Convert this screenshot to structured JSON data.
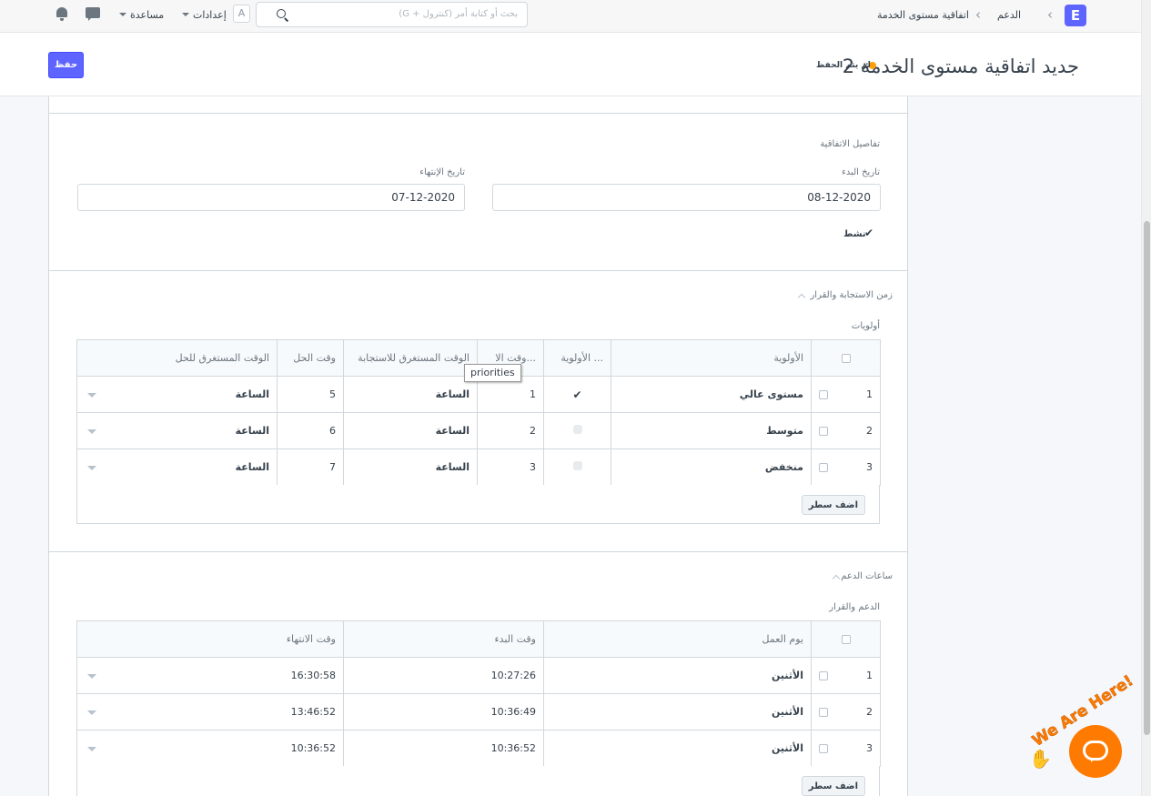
{
  "navbar": {
    "logo": "E",
    "breadcrumbs": [
      "الدعم",
      "اتفاقية مستوى الخدمة"
    ],
    "search_placeholder": "بحث أو كتابة أمر (كنترول + G)",
    "avatar": "A",
    "settings": "إعدادات",
    "help": "مساعدة"
  },
  "page": {
    "title": "جديد اتفاقية مستوى الخدمة 2",
    "status": "لم يتم الحفظ",
    "save_button": "حفظ"
  },
  "details": {
    "section_title": "تفاصيل الاتفاقية",
    "start_date_label": "تاريخ البدء",
    "start_date": "08-12-2020",
    "end_date_label": "تاريخ الإنتهاء",
    "end_date": "07-12-2020",
    "active_label": "نشط"
  },
  "response": {
    "section_title": "زمن الاستجابة والقرار",
    "table_label": "أولويات",
    "columns": [
      "الأولوية",
      "الأولوية ...",
      "وقت الا...",
      "الوقت المستغرق للاستجابة",
      "وقت الحل",
      "الوقت المستغرق للحل"
    ],
    "rows": [
      {
        "idx": "1",
        "priority": "مستوى عالي",
        "default": true,
        "response_time": "1",
        "response_unit": "الساعة",
        "resolution_time": "5",
        "resolution_unit": "الساعة"
      },
      {
        "idx": "2",
        "priority": "متوسط",
        "default": false,
        "response_time": "2",
        "response_unit": "الساعة",
        "resolution_time": "6",
        "resolution_unit": "الساعة"
      },
      {
        "idx": "3",
        "priority": "منخفض",
        "default": false,
        "response_time": "3",
        "response_unit": "الساعة",
        "resolution_time": "7",
        "resolution_unit": "الساعة"
      }
    ],
    "add_row": "اضف سطر",
    "tooltip": "priorities"
  },
  "support_hours": {
    "section_title": "ساعات الدعم",
    "table_label": "الدعم والقرار",
    "columns": [
      "يوم العمل",
      "وقت البدء",
      "وقت الانتهاء"
    ],
    "rows": [
      {
        "idx": "1",
        "day": "الأثنين",
        "start": "10:27:26",
        "end": "16:30:58"
      },
      {
        "idx": "2",
        "day": "الأثنين",
        "start": "10:36:49",
        "end": "13:46:52"
      },
      {
        "idx": "3",
        "day": "الأثنين",
        "start": "10:36:52",
        "end": "10:36:52"
      }
    ],
    "add_row": "اضف سطر"
  },
  "chat_widget": {
    "tagline": "We Are Here!"
  },
  "colors": {
    "primary": "#5e64ff",
    "unsaved_dot": "#ffa00a",
    "chat": "#ff7a00"
  }
}
